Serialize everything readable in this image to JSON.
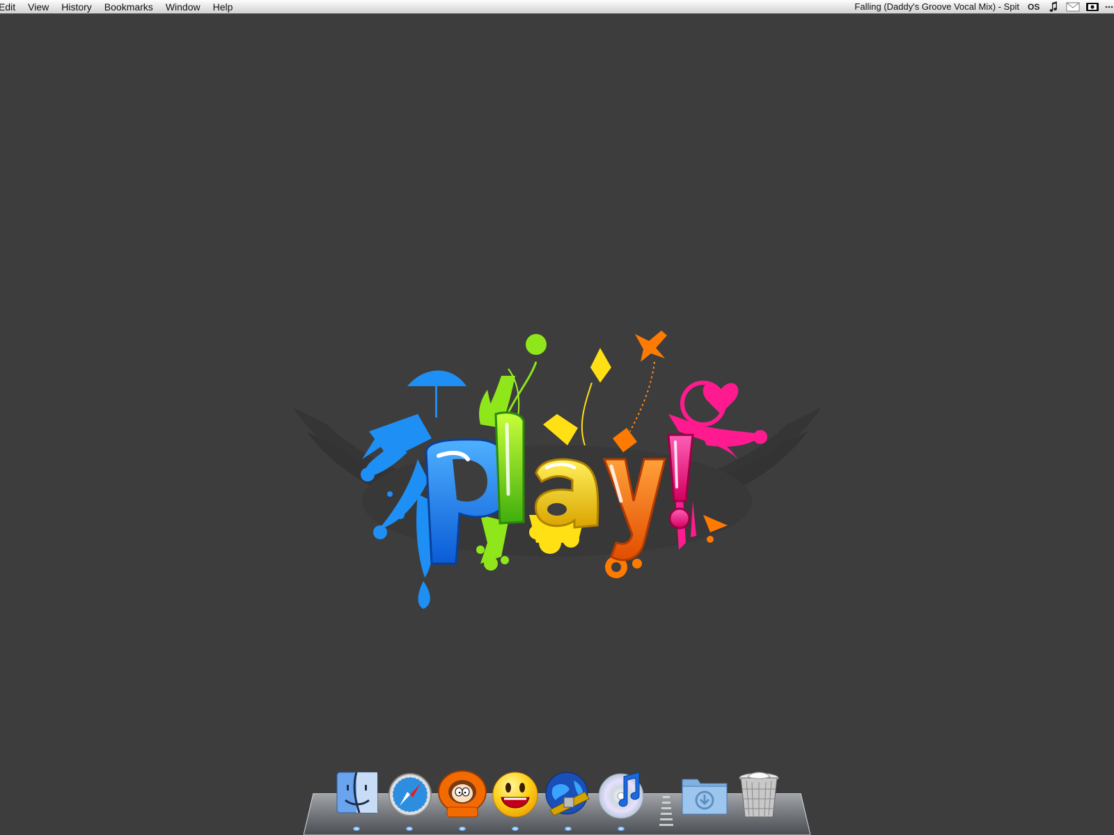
{
  "menubar": {
    "items": [
      "Edit",
      "View",
      "History",
      "Bookmarks",
      "Window",
      "Help"
    ],
    "now_playing": "Falling (Daddy's Groove Vocal Mix) - Spit",
    "status_icons": [
      "lastfm-icon",
      "music-note-icon",
      "mail-icon",
      "screen-capture-icon",
      "more-icon"
    ]
  },
  "wallpaper": {
    "logo_text": "play!",
    "background_color": "#3d3d3d",
    "colors": [
      "#1e90ff",
      "#7fe01a",
      "#ffe000",
      "#ff7a00",
      "#ff1493"
    ]
  },
  "dock": {
    "apps": [
      {
        "name": "Finder",
        "icon": "finder-icon"
      },
      {
        "name": "Safari",
        "icon": "safari-compass-icon"
      },
      {
        "name": "Kenny",
        "icon": "kenny-icon"
      },
      {
        "name": "Yahoo! Messenger",
        "icon": "smiley-icon"
      },
      {
        "name": "Network Globe",
        "icon": "globe-satellite-icon"
      },
      {
        "name": "iTunes",
        "icon": "itunes-cd-icon"
      }
    ],
    "stacks": [
      {
        "name": "Downloads",
        "icon": "downloads-folder-icon"
      },
      {
        "name": "Trash",
        "icon": "trash-icon"
      }
    ]
  }
}
